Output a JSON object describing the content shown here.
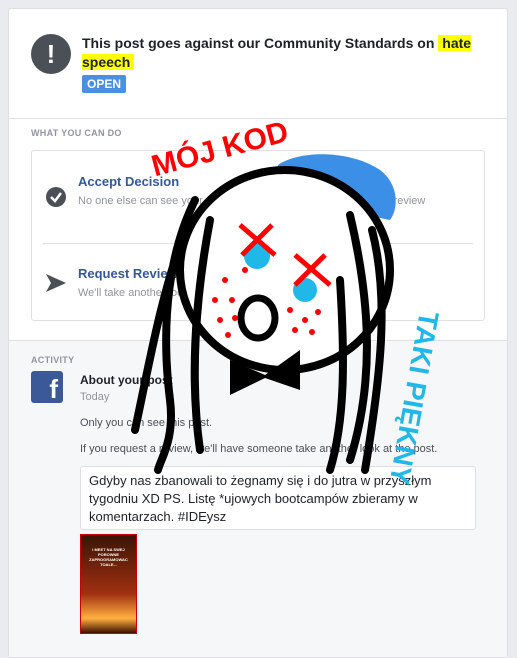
{
  "header": {
    "headline_prefix": "This post goes against our Community Standards on",
    "headline_highlight": "hate speech",
    "status_badge": "OPEN"
  },
  "what_you_can_do": {
    "section_label": "WHAT YOU CAN DO",
    "options": [
      {
        "title": "Accept Decision",
        "description": "No one else can see your post. You can still choose to request a review",
        "icon": "check-circle-icon"
      },
      {
        "title": "Request Review",
        "description": "We'll take another look at the post",
        "icon": "send-arrow-icon"
      }
    ]
  },
  "activity": {
    "section_label": "ACTIVITY",
    "entry_title": "About your post",
    "entry_date": "Today",
    "line1": "Only you can see this post.",
    "line2": "If you request a review, we'll have someone take another look at the post.",
    "post_text": "Gdyby nas zbanowali to żegnamy się i do jutra w przyszłym tygodniu XD PS. Listę *ujowych bootcampów zbieramy w komentarzach. #IDEysz",
    "thumbnail_text": "I MEET NA SWEJ POROWNE ZAPROGRAMOWAC TOALE..."
  },
  "doodle": {
    "text_top": "MÓJ KOD",
    "text_side": "TAKI PIĘKNY",
    "colors": {
      "red": "#ff0000",
      "blue": "#3b8fe6",
      "cyan": "#1fb8e8",
      "black": "#000000"
    }
  }
}
